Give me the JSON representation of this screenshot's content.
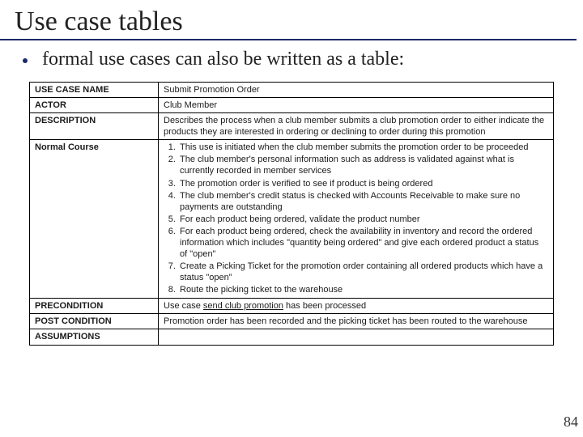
{
  "title": "Use case tables",
  "subtitle": "formal use cases can also be written as a table:",
  "rows": {
    "useCaseName": {
      "label": "USE CASE NAME",
      "value": "Submit Promotion Order"
    },
    "actor": {
      "label": "ACTOR",
      "value": "Club Member"
    },
    "description": {
      "label": "DESCRIPTION",
      "value": "Describes the process when a club member submits a club promotion order to either indicate the products they are interested in ordering or declining to order during this promotion"
    },
    "normalCourse": {
      "label": "Normal Course",
      "steps": [
        "This use is initiated when the club member submits the promotion order to be proceeded",
        "The club member's personal information such as address is validated against what is currently recorded in member services",
        "The promotion order is verified to see if product is being ordered",
        "The club member's credit status is checked with Accounts Receivable to make sure no payments are outstanding",
        "For each product being ordered, validate the product number",
        "For each product being ordered, check the availability in inventory and record the ordered information which includes \"quantity being ordered\" and give each ordered product a status of \"open\"",
        "Create a Picking Ticket for the promotion order containing all ordered products which have a status \"open\"",
        "Route the picking ticket to the warehouse"
      ]
    },
    "precondition": {
      "label": "PRECONDITION",
      "prefix": "Use case ",
      "underlined": "send club promotion",
      "suffix": " has been processed"
    },
    "postcondition": {
      "label": "POST CONDITION",
      "value": "Promotion order has been recorded and the picking ticket has been routed to the warehouse"
    },
    "assumptions": {
      "label": "ASSUMPTIONS",
      "value": ""
    }
  },
  "pageNumber": "84"
}
